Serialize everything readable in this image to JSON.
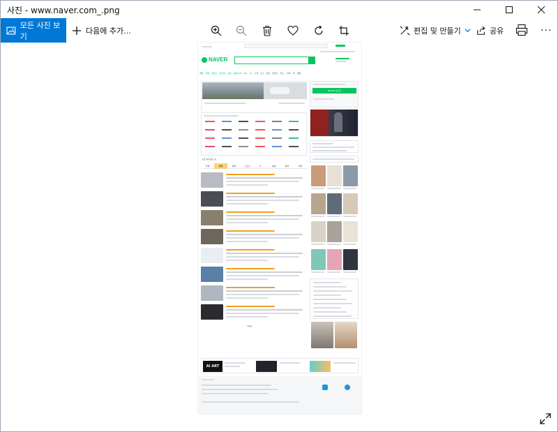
{
  "window": {
    "title": "사진 - www.naver.com_.png"
  },
  "toolbar": {
    "all_photos": "모든 사진 보기",
    "add_to": "다음에 추가...",
    "edit_create": "편집 및 만들기",
    "share": "공유",
    "more": "···"
  },
  "naver": {
    "logo": "NAVER",
    "login_button": "NAVER 로그인",
    "news_tabs": [
      "전체",
      "연예",
      "경제",
      "스포츠",
      "IT",
      "생활",
      "문화",
      "세계"
    ],
    "shortcuts": [
      "메일",
      "카페",
      "블로그",
      "지식iN",
      "쇼핑",
      "쇼핑LIVE",
      "Pay",
      "TV",
      "사전",
      "뉴스",
      "증권",
      "부동산",
      "지도",
      "VIBE",
      "책",
      "웹툰"
    ],
    "feed_title": "오늘 읽을만한 글",
    "more_label": "더보기",
    "ai_art": "AI ART"
  },
  "colors": {
    "accent": "#0078d7",
    "naver_green": "#03c75a",
    "title_text": "#111111"
  }
}
